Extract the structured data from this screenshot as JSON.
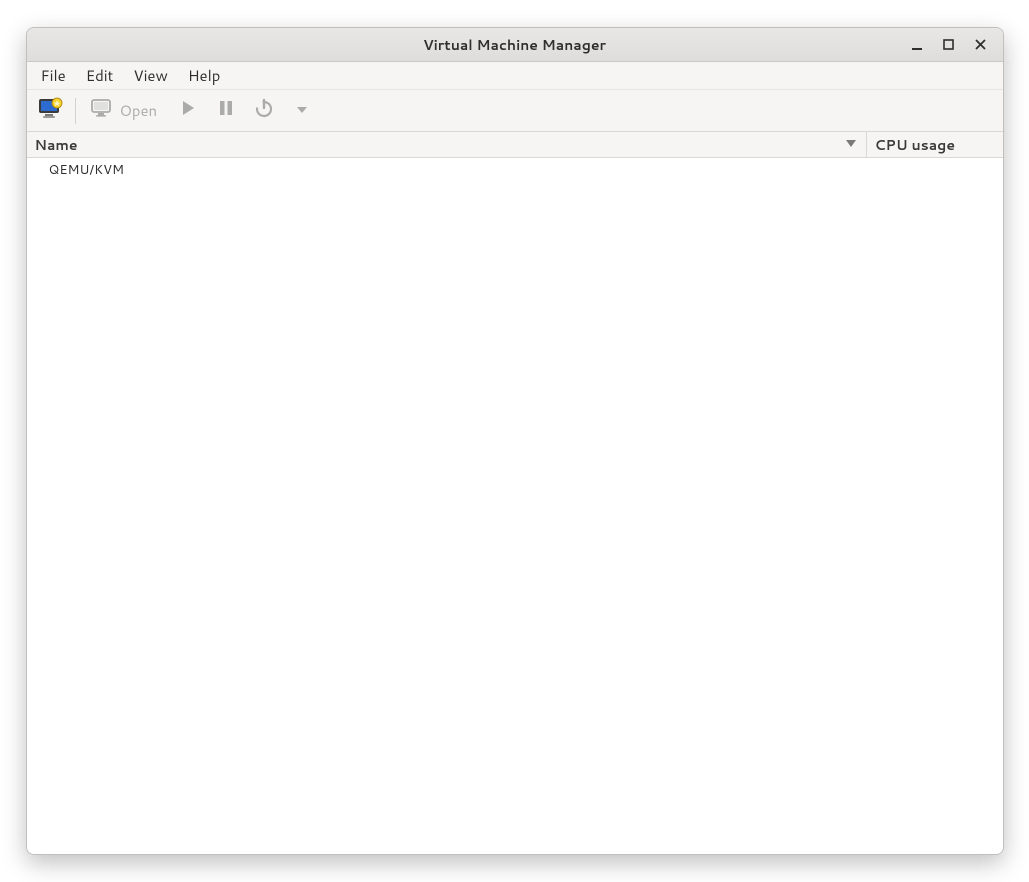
{
  "window": {
    "title": "Virtual Machine Manager"
  },
  "menu": {
    "file": "File",
    "edit": "Edit",
    "view": "View",
    "help": "Help"
  },
  "toolbar": {
    "open_label": "Open"
  },
  "columns": {
    "name": "Name",
    "cpu": "CPU usage"
  },
  "rows": [
    {
      "name": "QEMU/KVM",
      "cpu": ""
    }
  ]
}
